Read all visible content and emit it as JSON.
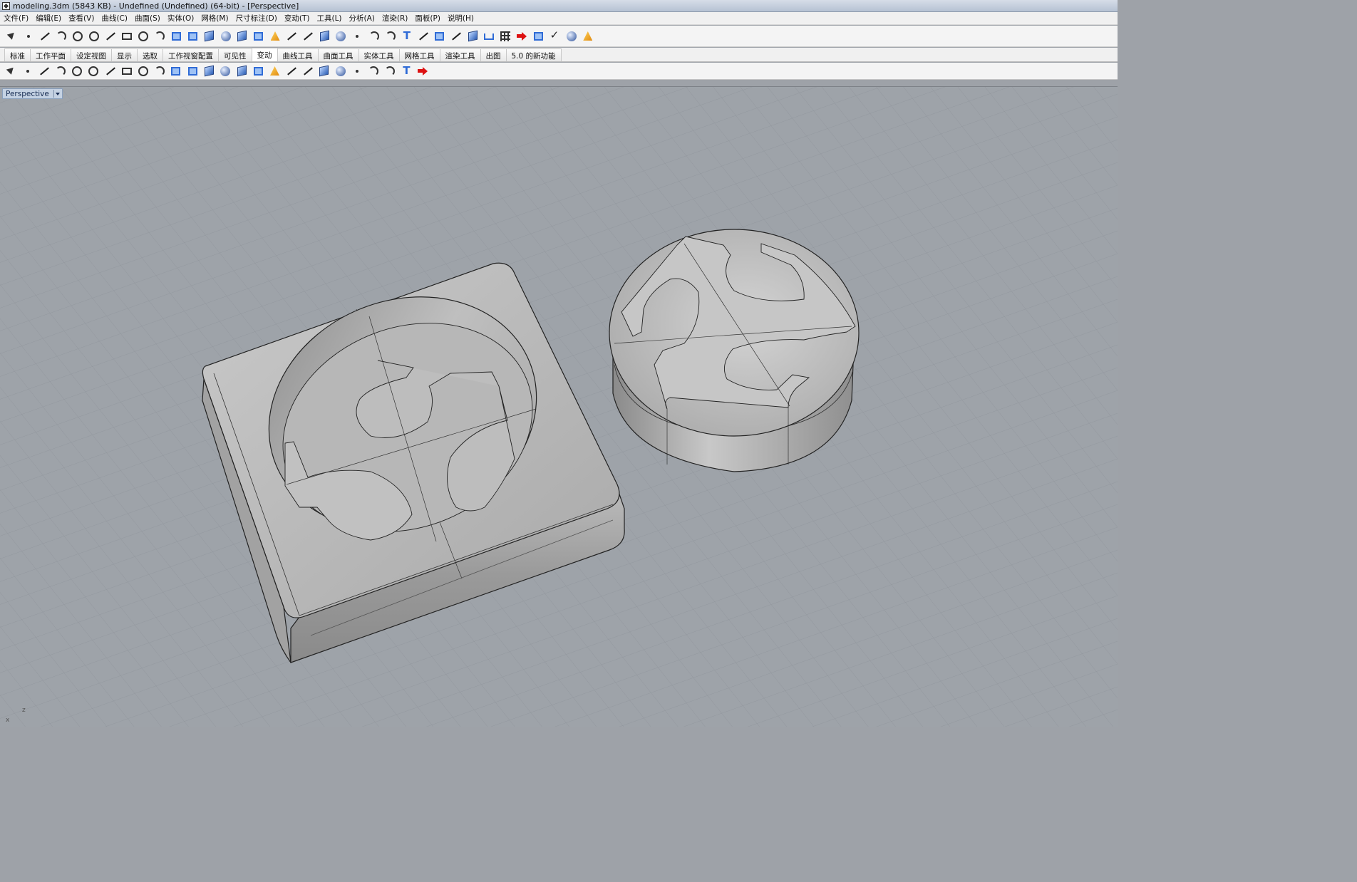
{
  "window": {
    "title": "modeling.3dm (5843 KB) - Undefined (Undefined) (64-bit) - [Perspective]"
  },
  "menu": [
    "文件(F)",
    "编辑(E)",
    "查看(V)",
    "曲线(C)",
    "曲面(S)",
    "实体(O)",
    "网格(M)",
    "尺寸标注(D)",
    "变动(T)",
    "工具(L)",
    "分析(A)",
    "渲染(R)",
    "面板(P)",
    "说明(H)"
  ],
  "toolbar1": {
    "icons": [
      "select-arrow-icon",
      "point-icon",
      "polyline-icon",
      "curve-icon",
      "circle-icon",
      "ellipse-icon",
      "polygon-icon",
      "rectangle-icon",
      "arc-icon",
      "fillet-curve-icon",
      "surface-corner-icon",
      "extrude-surface-icon",
      "box-solid-icon",
      "sphere-solid-icon",
      "cylinder-icon",
      "plane-surface-icon",
      "explode-icon",
      "trim-icon",
      "split-icon",
      "join-icon",
      "boolean-union-icon",
      "points-on-icon",
      "curve-fillet-icon",
      "blend-curve-icon",
      "text-icon",
      "move-icon",
      "copy-icon",
      "rotate-icon",
      "shade-cube-icon",
      "dimension-icon",
      "array-grid-icon",
      "analyze-icon",
      "mesh-icon",
      "check-icon",
      "render-icon",
      "material-icon"
    ]
  },
  "tabs": [
    "标准",
    "工作平面",
    "设定视图",
    "显示",
    "选取",
    "工作视窗配置",
    "可见性",
    "变动",
    "曲线工具",
    "曲面工具",
    "实体工具",
    "网格工具",
    "渲染工具",
    "出图",
    "5.0 的新功能"
  ],
  "active_tab": "变动",
  "toolbar2": {
    "icons": [
      "move-icon",
      "orient-icon",
      "copy-icon",
      "rotate-icon",
      "scale-icon",
      "mirror-icon",
      "align-icon",
      "array-icon",
      "flow-icon",
      "twist-icon",
      "bend-icon",
      "taper-icon",
      "grid-array-icon",
      "polar-array-icon",
      "smash-icon",
      "cage-edit-icon",
      "set-points-icon",
      "project-icon",
      "orient-on-surface-icon",
      "shear-icon",
      "stretch-icon",
      "splop-icon",
      "smooth-icon",
      "boxedit-icon",
      "gumball-icon",
      "next-red-arrow-icon"
    ]
  },
  "viewport": {
    "label": "Perspective",
    "axis_z": "z",
    "axis_x": "x"
  }
}
